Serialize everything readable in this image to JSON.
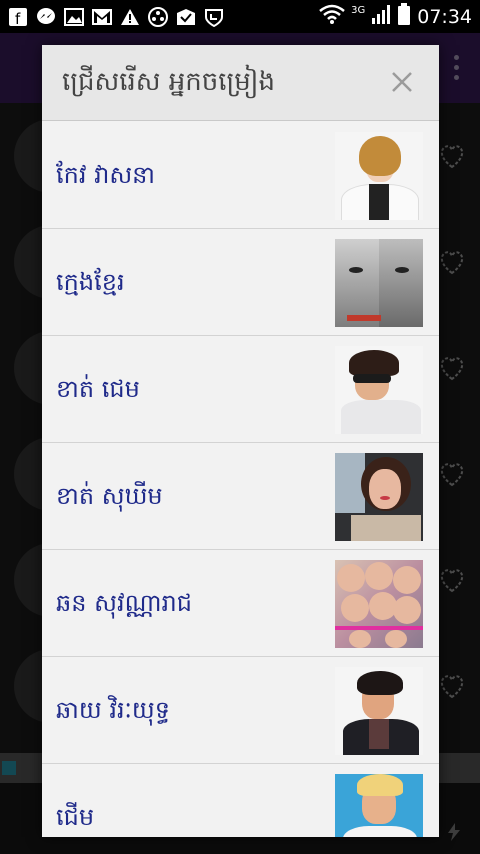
{
  "status_bar": {
    "network_label": "3G",
    "time": "07:34"
  },
  "dialog": {
    "title": "ជ្រើសរើស អ្នកចម្រៀង",
    "items": [
      {
        "name": "កែវ វាសនា"
      },
      {
        "name": "ក្មេងខ្មែរ"
      },
      {
        "name": "ខាត់ ជេម"
      },
      {
        "name": "ខាត់ សុឃីម"
      },
      {
        "name": "ឆន សុវណ្ណារាជ"
      },
      {
        "name": "ឆាយ វិរៈយុទ្ធ"
      },
      {
        "name": "ជើម"
      }
    ]
  }
}
